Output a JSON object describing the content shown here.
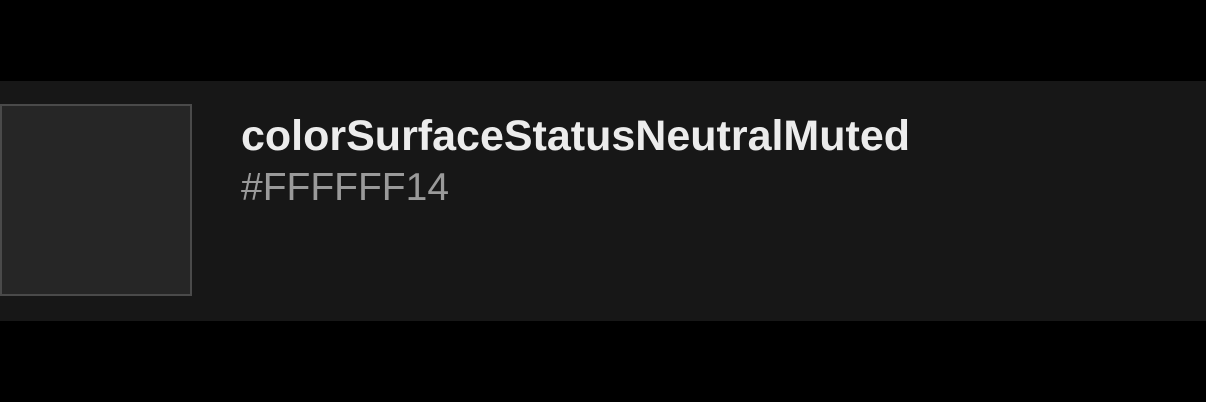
{
  "token": {
    "name": "colorSurfaceStatusNeutralMuted",
    "value": "#FFFFFF14"
  },
  "colors": {
    "page_background": "#000000",
    "row_background": "#171717",
    "swatch_fill": "#262626",
    "swatch_border": "#4a4a4a",
    "name_text": "#ececec",
    "value_text": "#9a9a9a"
  }
}
